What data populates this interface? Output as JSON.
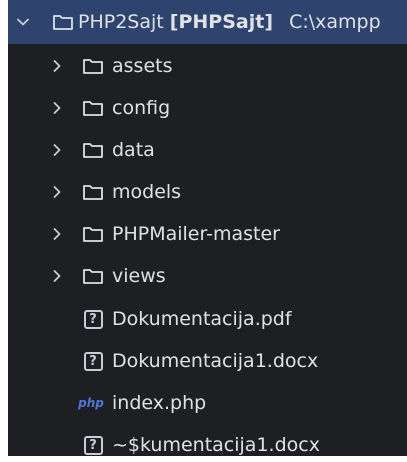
{
  "project_tree": {
    "root": {
      "name": "PHP2Sajt",
      "module": "[PHPSajt]",
      "path": "C:\\xampp"
    },
    "folders": [
      {
        "label": "assets"
      },
      {
        "label": "config"
      },
      {
        "label": "data"
      },
      {
        "label": "models"
      },
      {
        "label": "PHPMailer-master"
      },
      {
        "label": "views"
      }
    ],
    "files": [
      {
        "label": "Dokumentacija.pdf",
        "icon": "unknown-file-icon",
        "icon_glyph": "?"
      },
      {
        "label": "Dokumentacija1.docx",
        "icon": "unknown-file-icon",
        "icon_glyph": "?"
      },
      {
        "label": "index.php",
        "icon": "php-file-icon",
        "icon_glyph": "php"
      },
      {
        "label": "~$kumentacija1.docx",
        "icon": "unknown-file-icon",
        "icon_glyph": "?"
      }
    ]
  },
  "colors": {
    "background": "#1e1f22",
    "selection": "#2e436e",
    "text": "#dfe1e5",
    "php_icon": "#4f77d6"
  }
}
